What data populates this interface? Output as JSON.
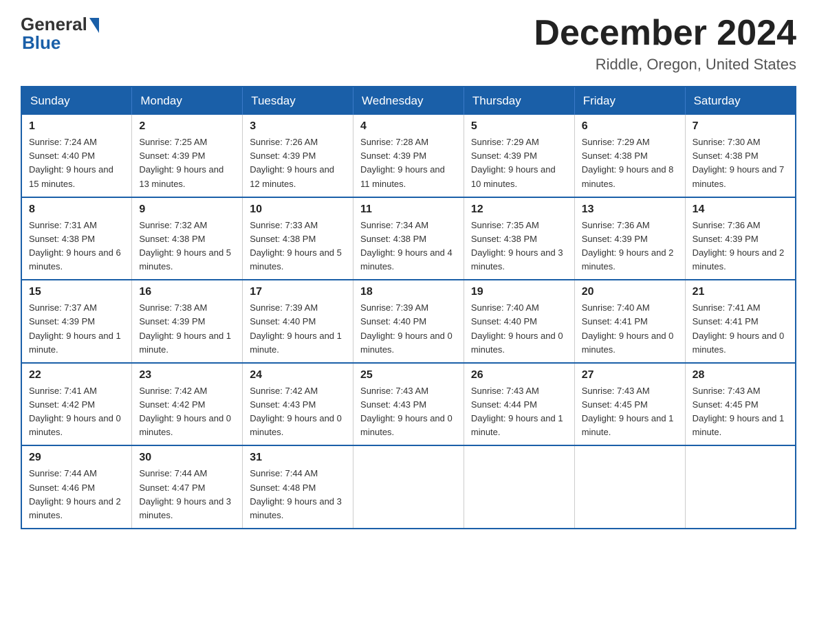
{
  "header": {
    "logo_general": "General",
    "logo_blue": "Blue",
    "month_title": "December 2024",
    "location": "Riddle, Oregon, United States"
  },
  "days_of_week": [
    "Sunday",
    "Monday",
    "Tuesday",
    "Wednesday",
    "Thursday",
    "Friday",
    "Saturday"
  ],
  "weeks": [
    [
      {
        "day": "1",
        "sunrise": "7:24 AM",
        "sunset": "4:40 PM",
        "daylight": "9 hours and 15 minutes."
      },
      {
        "day": "2",
        "sunrise": "7:25 AM",
        "sunset": "4:39 PM",
        "daylight": "9 hours and 13 minutes."
      },
      {
        "day": "3",
        "sunrise": "7:26 AM",
        "sunset": "4:39 PM",
        "daylight": "9 hours and 12 minutes."
      },
      {
        "day": "4",
        "sunrise": "7:28 AM",
        "sunset": "4:39 PM",
        "daylight": "9 hours and 11 minutes."
      },
      {
        "day": "5",
        "sunrise": "7:29 AM",
        "sunset": "4:39 PM",
        "daylight": "9 hours and 10 minutes."
      },
      {
        "day": "6",
        "sunrise": "7:29 AM",
        "sunset": "4:38 PM",
        "daylight": "9 hours and 8 minutes."
      },
      {
        "day": "7",
        "sunrise": "7:30 AM",
        "sunset": "4:38 PM",
        "daylight": "9 hours and 7 minutes."
      }
    ],
    [
      {
        "day": "8",
        "sunrise": "7:31 AM",
        "sunset": "4:38 PM",
        "daylight": "9 hours and 6 minutes."
      },
      {
        "day": "9",
        "sunrise": "7:32 AM",
        "sunset": "4:38 PM",
        "daylight": "9 hours and 5 minutes."
      },
      {
        "day": "10",
        "sunrise": "7:33 AM",
        "sunset": "4:38 PM",
        "daylight": "9 hours and 5 minutes."
      },
      {
        "day": "11",
        "sunrise": "7:34 AM",
        "sunset": "4:38 PM",
        "daylight": "9 hours and 4 minutes."
      },
      {
        "day": "12",
        "sunrise": "7:35 AM",
        "sunset": "4:38 PM",
        "daylight": "9 hours and 3 minutes."
      },
      {
        "day": "13",
        "sunrise": "7:36 AM",
        "sunset": "4:39 PM",
        "daylight": "9 hours and 2 minutes."
      },
      {
        "day": "14",
        "sunrise": "7:36 AM",
        "sunset": "4:39 PM",
        "daylight": "9 hours and 2 minutes."
      }
    ],
    [
      {
        "day": "15",
        "sunrise": "7:37 AM",
        "sunset": "4:39 PM",
        "daylight": "9 hours and 1 minute."
      },
      {
        "day": "16",
        "sunrise": "7:38 AM",
        "sunset": "4:39 PM",
        "daylight": "9 hours and 1 minute."
      },
      {
        "day": "17",
        "sunrise": "7:39 AM",
        "sunset": "4:40 PM",
        "daylight": "9 hours and 1 minute."
      },
      {
        "day": "18",
        "sunrise": "7:39 AM",
        "sunset": "4:40 PM",
        "daylight": "9 hours and 0 minutes."
      },
      {
        "day": "19",
        "sunrise": "7:40 AM",
        "sunset": "4:40 PM",
        "daylight": "9 hours and 0 minutes."
      },
      {
        "day": "20",
        "sunrise": "7:40 AM",
        "sunset": "4:41 PM",
        "daylight": "9 hours and 0 minutes."
      },
      {
        "day": "21",
        "sunrise": "7:41 AM",
        "sunset": "4:41 PM",
        "daylight": "9 hours and 0 minutes."
      }
    ],
    [
      {
        "day": "22",
        "sunrise": "7:41 AM",
        "sunset": "4:42 PM",
        "daylight": "9 hours and 0 minutes."
      },
      {
        "day": "23",
        "sunrise": "7:42 AM",
        "sunset": "4:42 PM",
        "daylight": "9 hours and 0 minutes."
      },
      {
        "day": "24",
        "sunrise": "7:42 AM",
        "sunset": "4:43 PM",
        "daylight": "9 hours and 0 minutes."
      },
      {
        "day": "25",
        "sunrise": "7:43 AM",
        "sunset": "4:43 PM",
        "daylight": "9 hours and 0 minutes."
      },
      {
        "day": "26",
        "sunrise": "7:43 AM",
        "sunset": "4:44 PM",
        "daylight": "9 hours and 1 minute."
      },
      {
        "day": "27",
        "sunrise": "7:43 AM",
        "sunset": "4:45 PM",
        "daylight": "9 hours and 1 minute."
      },
      {
        "day": "28",
        "sunrise": "7:43 AM",
        "sunset": "4:45 PM",
        "daylight": "9 hours and 1 minute."
      }
    ],
    [
      {
        "day": "29",
        "sunrise": "7:44 AM",
        "sunset": "4:46 PM",
        "daylight": "9 hours and 2 minutes."
      },
      {
        "day": "30",
        "sunrise": "7:44 AM",
        "sunset": "4:47 PM",
        "daylight": "9 hours and 3 minutes."
      },
      {
        "day": "31",
        "sunrise": "7:44 AM",
        "sunset": "4:48 PM",
        "daylight": "9 hours and 3 minutes."
      },
      null,
      null,
      null,
      null
    ]
  ]
}
